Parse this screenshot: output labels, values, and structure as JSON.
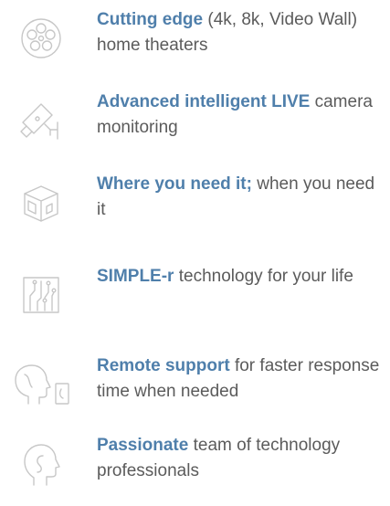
{
  "features": [
    {
      "icon": "film-reel-icon",
      "highlight": "Cutting edge",
      "text": " (4k, 8k, Video Wall) home theaters"
    },
    {
      "icon": "security-camera-icon",
      "highlight": "Advanced intelligent LIVE",
      "text": " camera monitoring"
    },
    {
      "icon": "room-cube-icon",
      "highlight": "Where you need it;",
      "text": " when you need it"
    },
    {
      "icon": "circuit-board-icon",
      "highlight": "SIMPLE-r",
      "text": " technology for your life"
    },
    {
      "icon": "head-phone-icon",
      "highlight": "Remote support",
      "text": " for faster response time when needed"
    },
    {
      "icon": "head-profile-icon",
      "highlight": "Passionate",
      "text": " team of technology professionals"
    }
  ],
  "colors": {
    "highlight": "#4f7fab",
    "text": "#5b5b5b",
    "icon": "#c7c7c7"
  }
}
